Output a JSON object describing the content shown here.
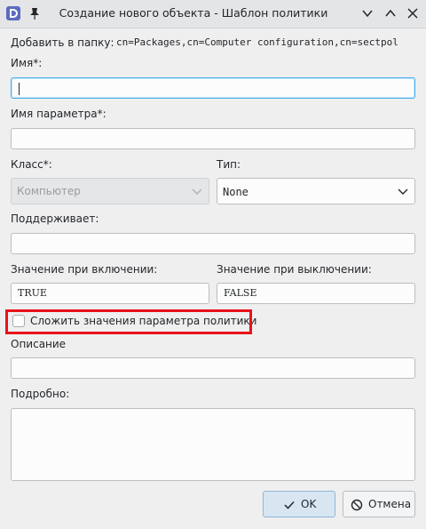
{
  "window": {
    "title": "Создание нового объекта - Шаблон политики"
  },
  "form": {
    "add_to_folder_label": "Добавить в папку:",
    "add_to_folder_value": "cn=Packages,cn=Computer configuration,cn=sectpol",
    "name_label": "Имя*:",
    "name_value": "",
    "param_name_label": "Имя параметра*:",
    "param_name_value": "",
    "class_label": "Класс*:",
    "class_value": "Компьютер",
    "type_label": "Тип:",
    "type_value": "None",
    "supports_label": "Поддерживает:",
    "supports_value": "",
    "on_value_label": "Значение при включении:",
    "on_value": "TRUE",
    "off_value_label": "Значение при выключении:",
    "off_value": "FALSE",
    "combine_checkbox_label": "Сложить значения параметра политики",
    "combine_checked": false,
    "description_label": "Описание",
    "description_value": "",
    "details_label": "Подробно:",
    "details_value": ""
  },
  "buttons": {
    "ok_label": "OK",
    "cancel_label": "Отмена"
  },
  "colors": {
    "accent": "#3daee9",
    "highlight_border": "#e8121a"
  }
}
